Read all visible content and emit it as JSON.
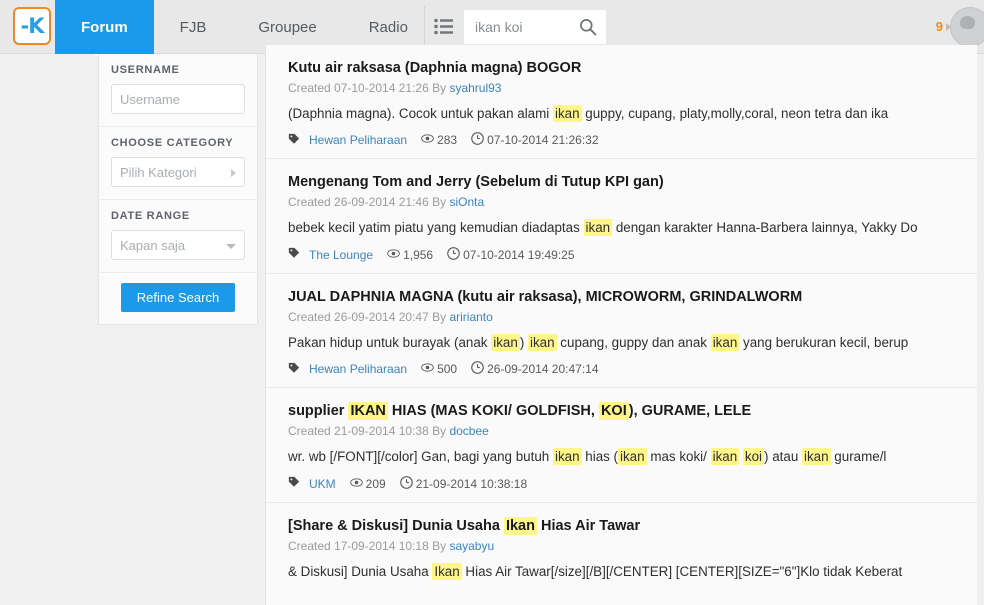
{
  "topnav": {
    "logo_alt": "kaskus-logo",
    "logo_letter": "-K",
    "tabs": [
      {
        "label": "Forum",
        "active": true
      },
      {
        "label": "FJB",
        "active": false
      },
      {
        "label": "Groupee",
        "active": false
      },
      {
        "label": "Radio",
        "active": false
      }
    ],
    "list_icon": "list-icon",
    "search": {
      "value": "ikan koi",
      "placeholder": "ikan koi",
      "icon": "search-icon"
    },
    "notification_count": "9",
    "avatar": "user-avatar"
  },
  "sidebar": {
    "username": {
      "label": "USERNAME",
      "placeholder": "Username",
      "value": ""
    },
    "category": {
      "label": "CHOOSE CATEGORY",
      "value": "Pilih Kategori",
      "icon": "chevron-right-icon"
    },
    "date_range": {
      "label": "DATE RANGE",
      "value": "Kapan saja",
      "icon": "chevron-down-icon"
    },
    "refine_button": "Refine Search"
  },
  "results": [
    {
      "title_parts": [
        {
          "t": "Kutu air raksasa (Daphnia magna) BOGOR",
          "h": false
        }
      ],
      "created": "Created 07-10-2014 21:26 By ",
      "author": "syahrul93",
      "snippet_parts": [
        {
          "t": "(Daphnia magna). Cocok untuk pakan alami ",
          "h": false
        },
        {
          "t": "ikan",
          "h": true
        },
        {
          "t": " guppy, cupang, platy,molly,coral, neon tetra dan ika",
          "h": false
        }
      ],
      "category": "Hewan Peliharaan",
      "views": "283",
      "timestamp": "07-10-2014 21:26:32"
    },
    {
      "title_parts": [
        {
          "t": "Mengenang Tom and Jerry (Sebelum di Tutup KPI gan)",
          "h": false
        }
      ],
      "created": "Created 26-09-2014 21:46 By ",
      "author": "siOnta",
      "snippet_parts": [
        {
          "t": "bebek kecil yatim piatu yang kemudian diadaptas ",
          "h": false
        },
        {
          "t": "ikan",
          "h": true
        },
        {
          "t": " dengan karakter Hanna-Barbera lainnya, Yakky Do",
          "h": false
        }
      ],
      "category": "The Lounge",
      "views": "1,956",
      "timestamp": "07-10-2014 19:49:25"
    },
    {
      "title_parts": [
        {
          "t": "JUAL DAPHNIA MAGNA (kutu air raksasa), MICROWORM, GRINDALWORM",
          "h": false
        }
      ],
      "created": "Created 26-09-2014 20:47 By ",
      "author": "aririanto",
      "snippet_parts": [
        {
          "t": "Pakan hidup untuk burayak (anak ",
          "h": false
        },
        {
          "t": "ikan",
          "h": true
        },
        {
          "t": ") ",
          "h": false
        },
        {
          "t": "ikan",
          "h": true
        },
        {
          "t": " cupang, guppy dan anak ",
          "h": false
        },
        {
          "t": "ikan",
          "h": true
        },
        {
          "t": " yang berukuran kecil, berup",
          "h": false
        }
      ],
      "category": "Hewan Peliharaan",
      "views": "500",
      "timestamp": "26-09-2014 20:47:14"
    },
    {
      "title_parts": [
        {
          "t": "supplier ",
          "h": false
        },
        {
          "t": "IKAN",
          "h": true
        },
        {
          "t": " HIAS (MAS KOKI/ GOLDFISH, ",
          "h": false
        },
        {
          "t": "KOI",
          "h": true
        },
        {
          "t": "), GURAME, LELE",
          "h": false
        }
      ],
      "created": "Created 21-09-2014 10:38 By ",
      "author": "docbee",
      "snippet_parts": [
        {
          "t": "wr. wb [/FONT][/color] Gan, bagi yang butuh ",
          "h": false
        },
        {
          "t": "ikan",
          "h": true
        },
        {
          "t": " hias (",
          "h": false
        },
        {
          "t": "ikan",
          "h": true
        },
        {
          "t": " mas koki/ ",
          "h": false
        },
        {
          "t": "ikan",
          "h": true
        },
        {
          "t": " ",
          "h": false
        },
        {
          "t": "koi",
          "h": true
        },
        {
          "t": ") atau ",
          "h": false
        },
        {
          "t": "ikan",
          "h": true
        },
        {
          "t": " gurame/l",
          "h": false
        }
      ],
      "category": "UKM",
      "views": "209",
      "timestamp": "21-09-2014 10:38:18"
    },
    {
      "title_parts": [
        {
          "t": "[Share & Diskusi] Dunia Usaha ",
          "h": false
        },
        {
          "t": "Ikan",
          "h": true
        },
        {
          "t": " Hias Air Tawar",
          "h": false
        }
      ],
      "created": "Created 17-09-2014 10:18 By ",
      "author": "sayabyu",
      "snippet_parts": [
        {
          "t": "& Diskusi] Dunia Usaha ",
          "h": false
        },
        {
          "t": "Ikan",
          "h": true
        },
        {
          "t": " Hias Air Tawar[/size][/B][/CENTER] [CENTER][SIZE=\"6\"]Klo tidak Keberat",
          "h": false
        }
      ],
      "category": "",
      "views": "",
      "timestamp": ""
    }
  ],
  "colors": {
    "accent_blue": "#1a9ae8",
    "logo_orange": "#f08a20",
    "highlight_yellow": "#fff68a",
    "link_blue": "#3b84c4"
  }
}
